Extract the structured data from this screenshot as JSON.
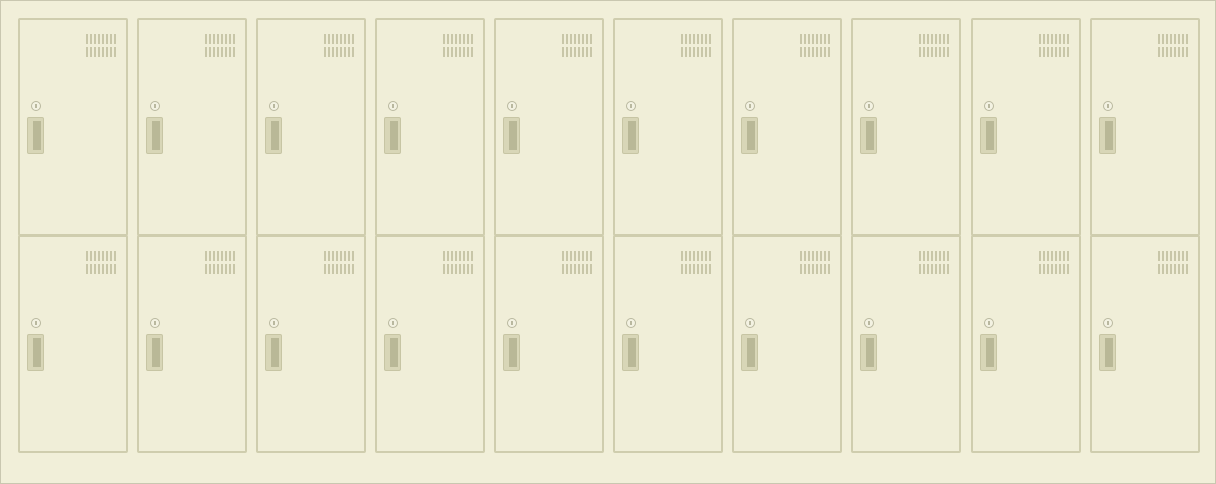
{
  "scene": "locker-bank",
  "rows": 2,
  "columns": 10,
  "colors": {
    "background": "#f1efd9",
    "door": "#f0eed8",
    "door_border": "#cfcdae",
    "vent_slot": "#c8c6a8",
    "handle": "#d8d6b7",
    "handle_grip": "#b9b897",
    "lock": "#b9b89f"
  },
  "icons": {
    "lock": "keyhole-lock-icon",
    "handle": "door-handle-icon",
    "vent": "vent-slots-icon"
  }
}
